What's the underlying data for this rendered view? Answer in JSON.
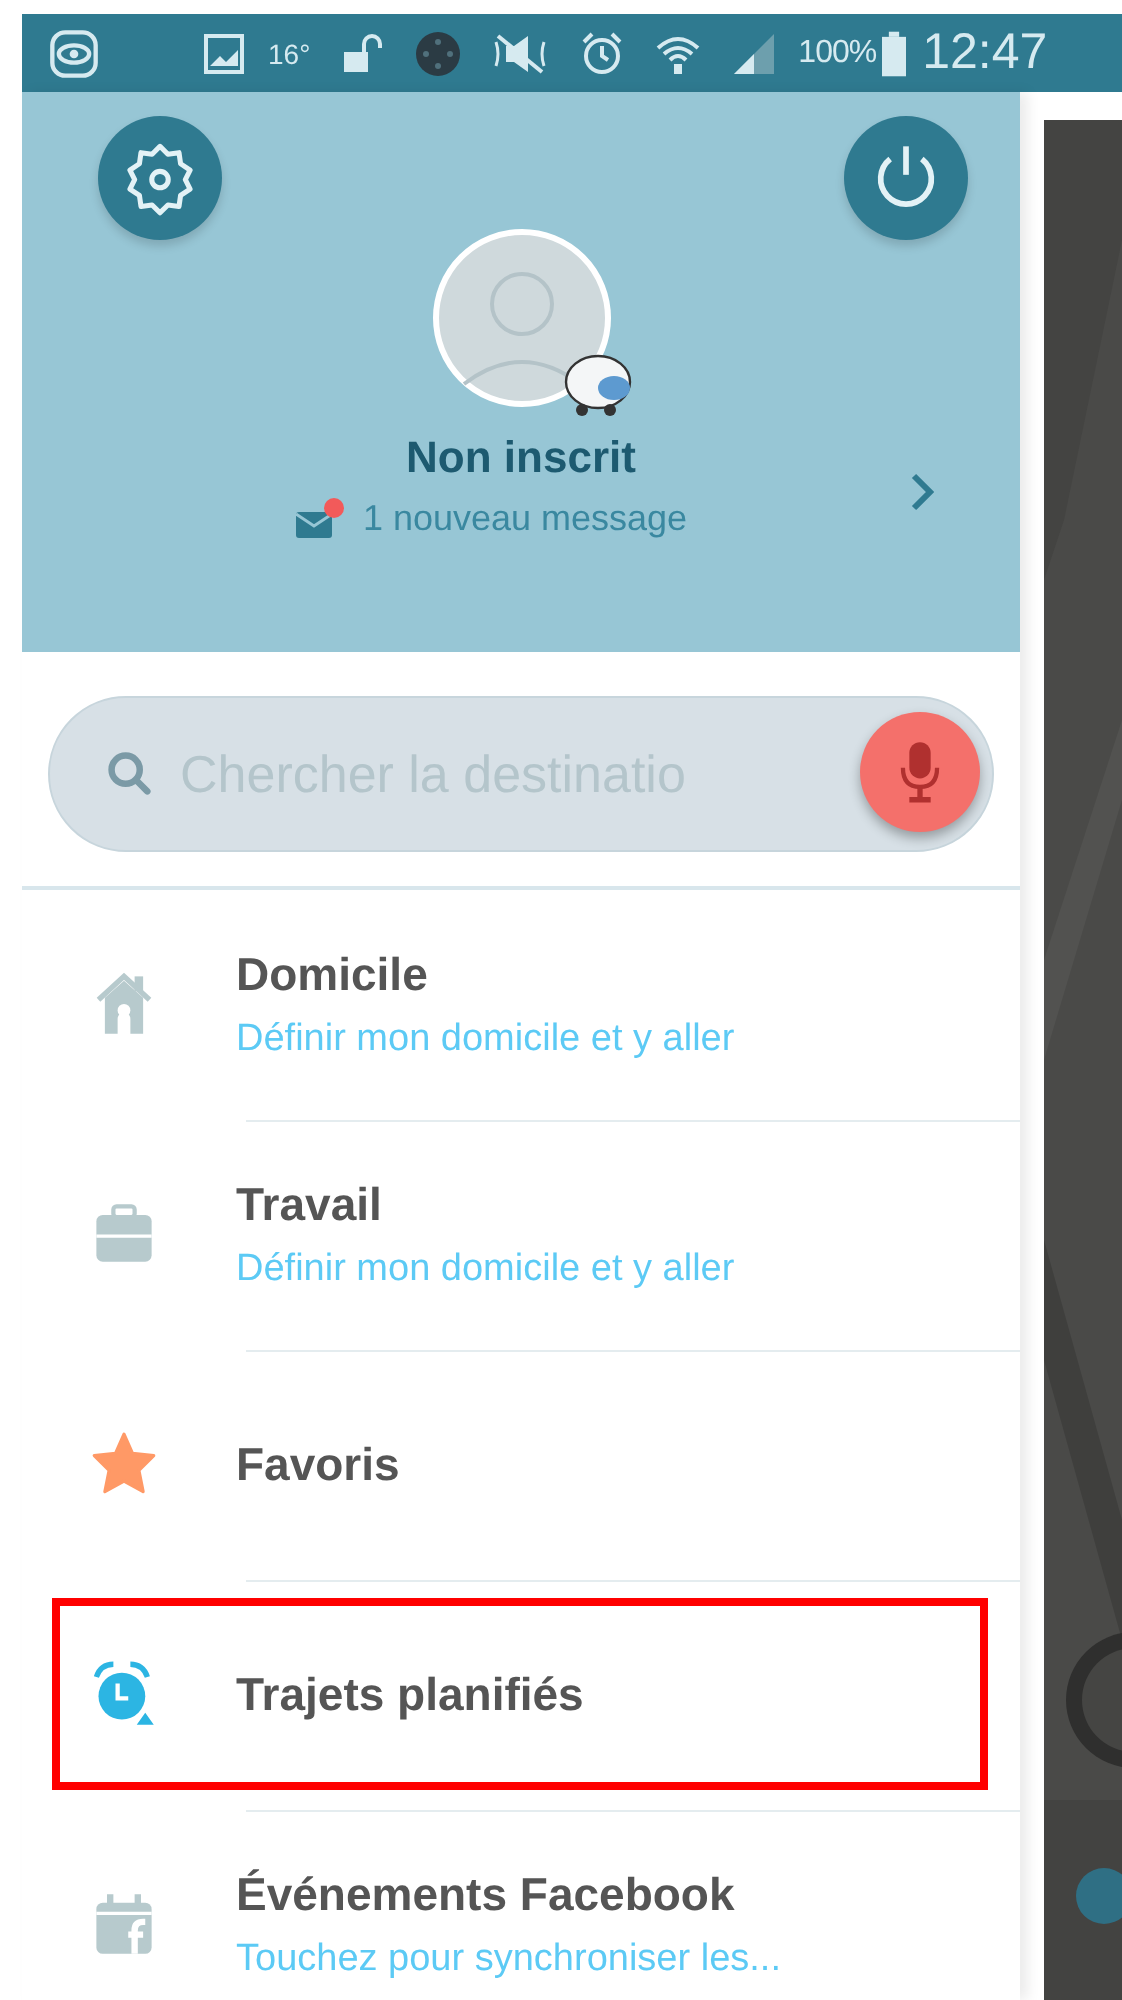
{
  "status_bar": {
    "temperature": "16°",
    "battery": "100%",
    "time": "12:47"
  },
  "profile": {
    "name": "Non inscrit",
    "message": "1 nouveau message",
    "unread": true
  },
  "search": {
    "placeholder": "Chercher la destinatio"
  },
  "menu_items": [
    {
      "kind": "home",
      "title": "Domicile",
      "subtitle": "Définir mon domicile et y aller",
      "highlighted": false
    },
    {
      "kind": "work",
      "title": "Travail",
      "subtitle": "Définir mon domicile et y aller",
      "highlighted": false
    },
    {
      "kind": "star",
      "title": "Favoris",
      "highlighted": false
    },
    {
      "kind": "alarm",
      "title": "Trajets planifiés",
      "highlighted": true
    },
    {
      "kind": "calendar",
      "title": "Événements Facebook",
      "subtitle": "Touchez pour synchroniser les..."
    }
  ]
}
